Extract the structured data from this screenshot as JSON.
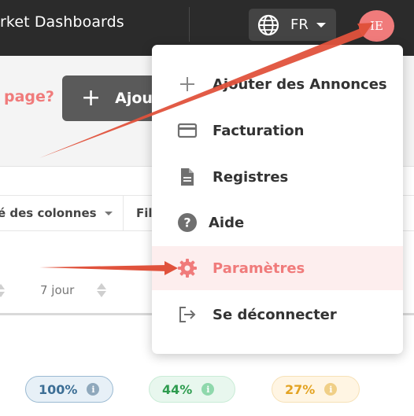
{
  "header": {
    "title": "rket Dashboards",
    "language": {
      "label": "FR",
      "icon": "globe-icon"
    },
    "avatar": {
      "initials": "IE",
      "color": "#f07b7b"
    }
  },
  "page": {
    "question": "page?",
    "add_button": {
      "label": "Ajout",
      "icon": "plus-icon"
    }
  },
  "toolbar": {
    "columns_label": "é des colonnes",
    "filter_label": "Fil"
  },
  "table": {
    "column_header": "7 jour",
    "stats": [
      {
        "value": "100%",
        "color": "#3c6e95"
      },
      {
        "value": "44%",
        "color": "#2e9c4f"
      },
      {
        "value": "27%",
        "color": "#e3a322"
      }
    ]
  },
  "menu": {
    "items": [
      {
        "label": "Ajouter des Annonces",
        "icon": "plus-icon"
      },
      {
        "label": "Facturation",
        "icon": "credit-card-icon"
      },
      {
        "label": "Registres",
        "icon": "document-icon"
      },
      {
        "label": "Aide",
        "icon": "help-circle-icon"
      },
      {
        "label": "Paramètres",
        "icon": "gear-icon",
        "active": true
      },
      {
        "label": "Se déconnecter",
        "icon": "logout-icon"
      }
    ],
    "accent_color": "#f07b7b"
  },
  "annotation_color": "#e0523c"
}
